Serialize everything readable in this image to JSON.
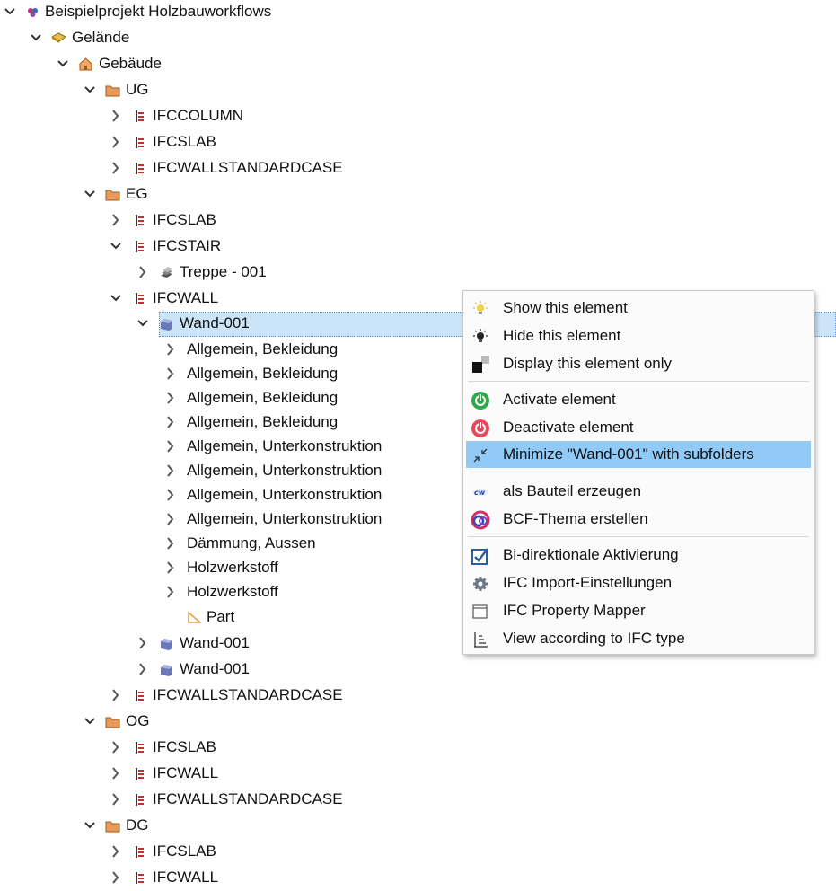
{
  "tree": {
    "root": "Beispielprojekt Holzbauworkflows",
    "site": "Gelände",
    "building": "Gebäude",
    "ug": {
      "label": "UG",
      "children": [
        "IFCCOLUMN",
        "IFCSLAB",
        "IFCWALLSTANDARDCASE"
      ]
    },
    "eg": {
      "label": "EG",
      "ifcslab": "IFCSLAB",
      "ifcstair": "IFCSTAIR",
      "treppe": "Treppe - 001",
      "ifcwall": "IFCWALL",
      "wand_selected": "Wand-001",
      "layers": [
        "Allgemein, Bekleidung",
        "Allgemein, Bekleidung",
        "Allgemein, Bekleidung",
        "Allgemein, Bekleidung",
        "Allgemein, Unterkonstruktion",
        "Allgemein, Unterkonstruktion",
        "Allgemein, Unterkonstruktion",
        "Allgemein, Unterkonstruktion",
        "Dämmung, Aussen",
        "Holzwerkstoff",
        "Holzwerkstoff"
      ],
      "part": "Part",
      "wand_2": "Wand-001",
      "wand_3": "Wand-001",
      "ifcwallstd": "IFCWALLSTANDARDCASE"
    },
    "og": {
      "label": "OG",
      "children": [
        "IFCSLAB",
        "IFCWALL",
        "IFCWALLSTANDARDCASE"
      ]
    },
    "dg": {
      "label": "DG",
      "children": [
        "IFCSLAB",
        "IFCWALL"
      ]
    }
  },
  "context_menu": {
    "items": [
      {
        "label": "Show this element",
        "icon": "lightbulb-on-icon"
      },
      {
        "label": "Hide this element",
        "icon": "lightbulb-off-icon"
      },
      {
        "label": "Display this element only",
        "icon": "isolate-icon"
      },
      {
        "label": "Activate element",
        "icon": "power-green-icon"
      },
      {
        "label": "Deactivate element",
        "icon": "power-red-icon"
      },
      {
        "label": "Minimize \"Wand-001\" with subfolders",
        "icon": "collapse-arrows-icon",
        "highlighted": true
      },
      {
        "label": "als Bauteil erzeugen",
        "icon": "cw-icon"
      },
      {
        "label": "BCF-Thema erstellen",
        "icon": "bcf-icon"
      },
      {
        "label": "Bi-direktionale Aktivierung",
        "icon": "checkbox-checked-icon"
      },
      {
        "label": "IFC Import-Einstellungen",
        "icon": "gear-icon"
      },
      {
        "label": "IFC Property Mapper",
        "icon": "window-icon"
      },
      {
        "label": "View according to IFC type",
        "icon": "list-icon"
      }
    ]
  },
  "colors": {
    "selection": "#cce4f7",
    "menu_highlight": "#91c9f7",
    "folder": "#d98a4a"
  }
}
